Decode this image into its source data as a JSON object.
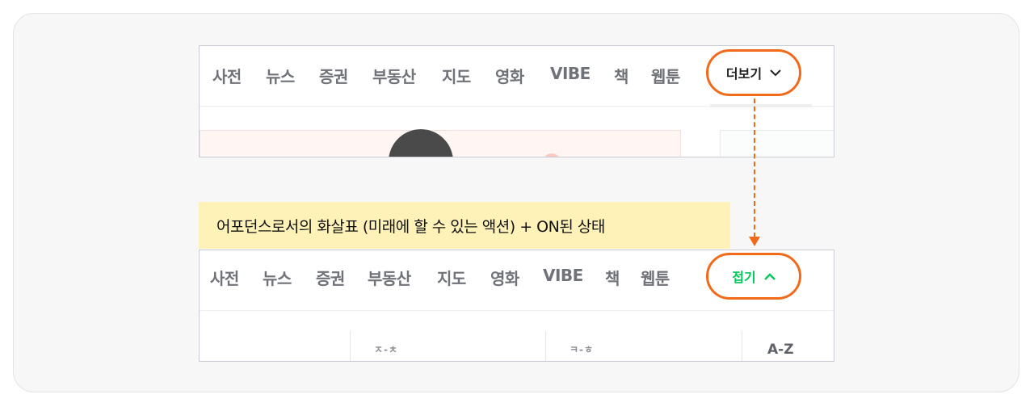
{
  "collapsed_nav": {
    "items": [
      "사전",
      "뉴스",
      "증권",
      "부동산",
      "지도",
      "영화",
      "VIBE",
      "책",
      "웹툰"
    ],
    "toggle_label": "더보기",
    "toggle_icon": "chevron-down-icon"
  },
  "annotation": {
    "text": "어포던스로서의 화살표 (미래에 할 수 있는 액션) + ON된 상태"
  },
  "expanded_nav": {
    "items": [
      "사전",
      "뉴스",
      "증권",
      "부동산",
      "지도",
      "영화",
      "VIBE",
      "책",
      "웹툰"
    ],
    "toggle_label": "접기",
    "toggle_icon": "chevron-up-icon",
    "toggle_color": "#03c75a",
    "columns": [
      "ㅈ-ㅊ",
      "ㅋ-ㅎ",
      "A-Z"
    ]
  },
  "colors": {
    "highlight": "#f06a1a",
    "annotation_bg": "#fff2b8",
    "nav_text": "#6f7278"
  }
}
